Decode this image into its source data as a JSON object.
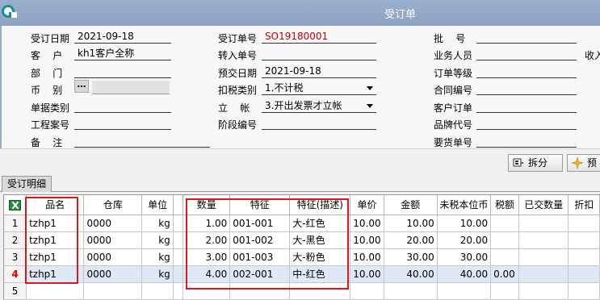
{
  "window": {
    "title": "受订单"
  },
  "header": {
    "order_date_label": "受订日期",
    "order_date": "2021-09-18",
    "customer_label": "客    户",
    "customer": "kh1客户全称",
    "department_label": "部    门",
    "department": "",
    "currency_label": "币    别",
    "currency": "",
    "doc_category_label": "单据类别",
    "doc_category": "",
    "project_label": "工程案号",
    "project": "",
    "remark_label": "备    注",
    "remark": "",
    "order_no_label": "受订单号",
    "order_no": "SO19180001",
    "transfer_no_label": "转入单号",
    "transfer_no": "",
    "delivery_date_label": "预交日期",
    "delivery_date": "2021-09-18",
    "tax_type_label": "扣税类别",
    "tax_type": "1.不计税",
    "account_label": "立    帐",
    "account": "3.开出发票才立帐",
    "stage_no_label": "阶段编号",
    "stage_no": "",
    "batch_no_label": "批    号",
    "batch_no": "",
    "sales_person_label": "业务人员",
    "sales_person": "",
    "receive_label": "收入",
    "order_level_label": "订单等级",
    "order_level": "",
    "contract_no_label": "合同编号",
    "contract_no": "",
    "customer_order_label": "客户订单",
    "customer_order": "",
    "brand_code_label": "品牌代号",
    "brand_code": "",
    "ship_no_label": "要货单号",
    "ship_no": ""
  },
  "toolbar": {
    "split_label": "拆分",
    "preview_label": "预"
  },
  "tabs": [
    {
      "label": "受订明细"
    }
  ],
  "grid": {
    "columns": [
      "品名",
      "仓库",
      "单位",
      "数量",
      "特征",
      "特征(描述)",
      "单价",
      "金额",
      "未税本位币",
      "税额",
      "已交数量",
      "折扣"
    ],
    "rows": [
      {
        "rn": "1",
        "name": "tzhp1",
        "warehouse": "0000",
        "unit": "kg",
        "qty": "1.00",
        "feature": "001-001",
        "feature_desc": "大-红色",
        "price": "10.00",
        "amount": "10.00",
        "pretax": "10.00",
        "tax": "",
        "delivered": "",
        "discount": ""
      },
      {
        "rn": "2",
        "name": "tzhp1",
        "warehouse": "0000",
        "unit": "kg",
        "qty": "2.00",
        "feature": "001-002",
        "feature_desc": "大-黑色",
        "price": "10.00",
        "amount": "20.00",
        "pretax": "20.00",
        "tax": "",
        "delivered": "",
        "discount": ""
      },
      {
        "rn": "3",
        "name": "tzhp1",
        "warehouse": "0000",
        "unit": "kg",
        "qty": "3.00",
        "feature": "001-003",
        "feature_desc": "大-粉色",
        "price": "10.00",
        "amount": "30.00",
        "pretax": "30.00",
        "tax": "",
        "delivered": "",
        "discount": ""
      },
      {
        "rn": "4",
        "name": "tzhp1",
        "warehouse": "0000",
        "unit": "kg",
        "qty": "4.00",
        "feature": "002-001",
        "feature_desc": "中-红色",
        "price": "10.00",
        "amount": "40.00",
        "pretax": "40.00",
        "tax": "0.00",
        "delivered": "",
        "discount": ""
      },
      {
        "rn": "5",
        "name": "",
        "warehouse": "",
        "unit": "",
        "qty": "",
        "feature": "",
        "feature_desc": "",
        "price": "",
        "amount": "",
        "pretax": "",
        "tax": "",
        "delivered": "",
        "discount": ""
      }
    ]
  },
  "colors": {
    "titlebar": "#8ea3c2",
    "highlight": "#e0161c",
    "order_no_text": "#c00000",
    "selected_row": "#dfe8f6"
  }
}
